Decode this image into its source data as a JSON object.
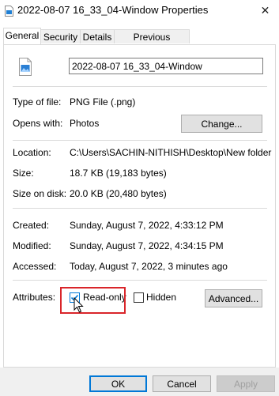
{
  "window": {
    "title": "2022-08-07 16_33_04-Window Properties",
    "close_glyph": "✕"
  },
  "tabs": [
    {
      "label": "General",
      "active": true
    },
    {
      "label": "Security",
      "active": false
    },
    {
      "label": "Details",
      "active": false
    },
    {
      "label": "Previous Versions",
      "active": false
    }
  ],
  "file": {
    "name": "2022-08-07 16_33_04-Window",
    "icon": "png-file-icon"
  },
  "type": {
    "label": "Type of file:",
    "value": "PNG File (.png)"
  },
  "opens": {
    "label": "Opens with:",
    "value": "Photos",
    "button": "Change..."
  },
  "location": {
    "label": "Location:",
    "value": "C:\\Users\\SACHIN-NITHISH\\Desktop\\New folder"
  },
  "size": {
    "label": "Size:",
    "value": "18.7 KB (19,183 bytes)"
  },
  "size_on_disk": {
    "label": "Size on disk:",
    "value": "20.0 KB (20,480 bytes)"
  },
  "created": {
    "label": "Created:",
    "value": "Sunday, August 7, 2022, 4:33:12 PM"
  },
  "modified": {
    "label": "Modified:",
    "value": "Sunday, August 7, 2022, 4:34:15 PM"
  },
  "accessed": {
    "label": "Accessed:",
    "value": "Today, August 7, 2022, 3 minutes ago"
  },
  "attributes": {
    "label": "Attributes:",
    "readonly": {
      "label": "Read-only",
      "checked": true
    },
    "hidden": {
      "label": "Hidden",
      "checked": false
    },
    "advanced_button": "Advanced..."
  },
  "footer": {
    "ok": "OK",
    "cancel": "Cancel",
    "apply": "Apply"
  },
  "colors": {
    "accent": "#0078d7",
    "highlight": "#d9252a",
    "check": "#0078d7"
  }
}
